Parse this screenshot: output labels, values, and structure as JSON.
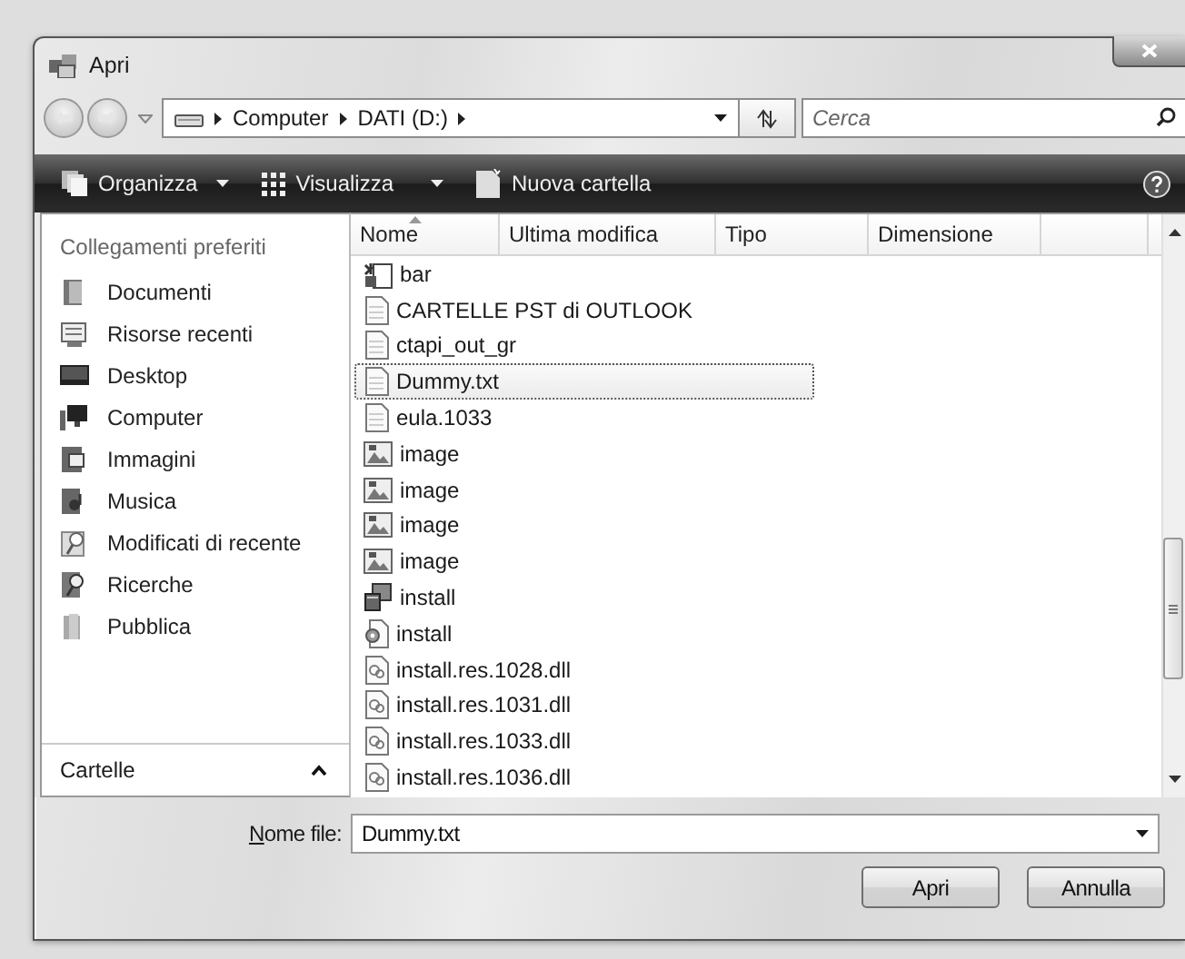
{
  "window": {
    "title": "Apri"
  },
  "address": {
    "path": [
      "Computer",
      "DATI (D:)"
    ]
  },
  "search": {
    "placeholder": "Cerca"
  },
  "toolbar": [
    {
      "label": "Organizza",
      "kind": "menu"
    },
    {
      "label": "Visualizza",
      "kind": "views"
    },
    {
      "label": "Nuova cartella",
      "kind": "new-folder"
    }
  ],
  "sidebar": {
    "heading": "Collegamenti preferiti",
    "items": [
      {
        "label": "Documenti"
      },
      {
        "label": "Risorse recenti"
      },
      {
        "label": "Desktop"
      },
      {
        "label": "Computer"
      },
      {
        "label": "Immagini"
      },
      {
        "label": "Musica"
      },
      {
        "label": "Modificati di recente"
      },
      {
        "label": "Ricerche"
      },
      {
        "label": "Pubblica"
      }
    ],
    "footer": "Cartelle"
  },
  "columns": [
    "Nome",
    "Ultima modifica",
    "Tipo",
    "Dimensione"
  ],
  "files": [
    {
      "name": "bar",
      "kind": "program",
      "selected": false
    },
    {
      "name": "CARTELLE PST di OUTLOOK",
      "kind": "document",
      "selected": false
    },
    {
      "name": "ctapi_out_gr",
      "kind": "document",
      "selected": false
    },
    {
      "name": "Dummy.txt",
      "kind": "document",
      "selected": true
    },
    {
      "name": "eula.1033",
      "kind": "document",
      "selected": false
    },
    {
      "name": "image",
      "kind": "image",
      "selected": false
    },
    {
      "name": "image",
      "kind": "image",
      "selected": false
    },
    {
      "name": "image",
      "kind": "image",
      "selected": false
    },
    {
      "name": "image",
      "kind": "image",
      "selected": false
    },
    {
      "name": "install",
      "kind": "installer",
      "selected": false
    },
    {
      "name": "install",
      "kind": "settings",
      "selected": false
    },
    {
      "name": "install.res.1028.dll",
      "kind": "library",
      "selected": false
    },
    {
      "name": "install.res.1031.dll",
      "kind": "library",
      "selected": false
    },
    {
      "name": "install.res.1033.dll",
      "kind": "library",
      "selected": false
    },
    {
      "name": "install.res.1036.dll",
      "kind": "library",
      "selected": false
    }
  ],
  "filename": {
    "label": "Nome file:",
    "value": "Dummy.txt"
  },
  "buttons": [
    "Apri",
    "Annulla"
  ]
}
